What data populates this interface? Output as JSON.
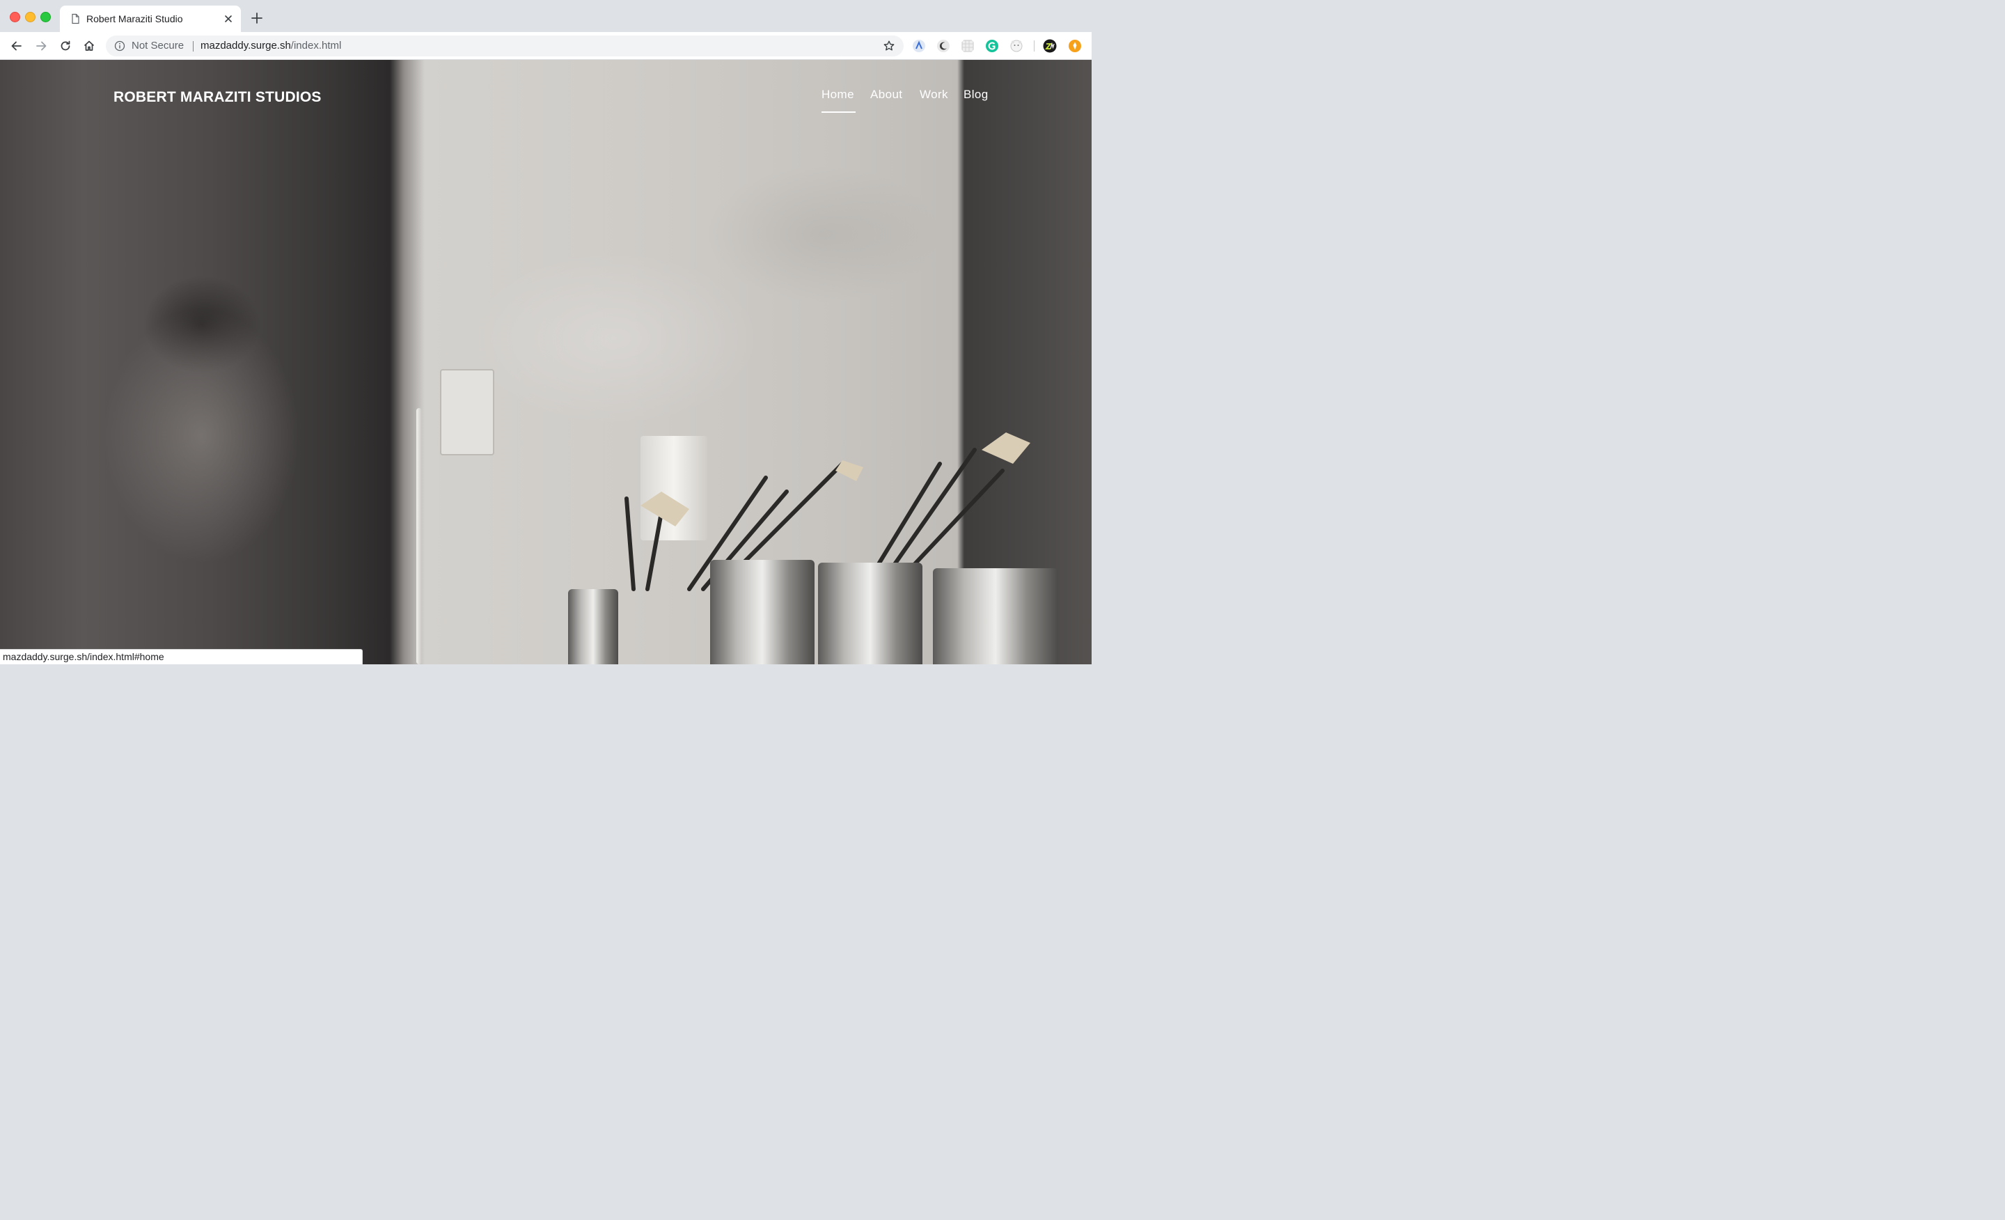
{
  "browser": {
    "tab": {
      "title": "Robert Maraziti Studio",
      "favicon": "page-icon"
    },
    "omnibox": {
      "security_label": "Not Secure",
      "url_host": "mazdaddy.surge.sh",
      "url_path": "/index.html"
    },
    "toolbar_icons": [
      "back-icon",
      "forward-icon",
      "reload-icon",
      "home-icon"
    ],
    "extensions": [
      "ext-blue-icon",
      "ext-moon-icon",
      "ext-grid-icon",
      "ext-grammarly-icon",
      "ext-bear-icon",
      "ext-avatar-icon",
      "ext-orange-icon"
    ],
    "status_url": "mazdaddy.surge.sh/index.html#home"
  },
  "site": {
    "brand": "ROBERT MARAZITI STUDIOS",
    "nav": {
      "home": "Home",
      "about": "About",
      "work": "Work",
      "blog": "Blog",
      "active": "Home"
    },
    "hero_image": "grayscale photo of a charcoal portrait drawing beside a studio wall with an outlet and cans of paintbrushes"
  },
  "colors": {
    "nav_text": "#ffffff",
    "tabstrip": "#dee1e6",
    "omnibox": "#f1f3f4"
  }
}
